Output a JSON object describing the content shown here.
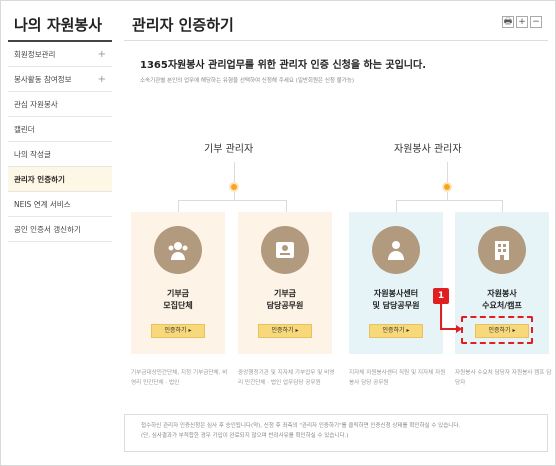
{
  "sidebar": {
    "title": "나의 자원봉사",
    "items": [
      {
        "label": "회원정보관리",
        "expand": "+"
      },
      {
        "label": "봉사활동 참여정보",
        "expand": "+"
      },
      {
        "label": "관심 자원봉사",
        "expand": ""
      },
      {
        "label": "캘린더",
        "expand": ""
      },
      {
        "label": "나의 작성글",
        "expand": ""
      },
      {
        "label": "관리자 인증하기",
        "expand": ""
      },
      {
        "label": "NEIS 연계 서비스",
        "expand": ""
      },
      {
        "label": "공인 인증서 갱신하기",
        "expand": ""
      }
    ]
  },
  "header": {
    "title": "관리자 인증하기",
    "tools": [
      "🖶",
      "+",
      "−"
    ]
  },
  "main": {
    "headline": "1365자원봉사 관리업무를 위한 관리자 인증 신청을 하는 곳입니다.",
    "subtext": "소속기관별 본인의 업무에 해당하는 유형을 선택하여 신청해 주세요 (일반회원은 신청 불가능)",
    "sections": [
      "기부 관리자",
      "자원봉사 관리자"
    ],
    "cards": [
      {
        "label": "기부금\n모집단체",
        "button": "인증하기 ▸",
        "icon": "people-icon"
      },
      {
        "label": "기부금\n담당공무원",
        "button": "인증하기 ▸",
        "icon": "id-card-icon"
      },
      {
        "label": "자원봉사센터\n및 담당공무원",
        "button": "인증하기 ▸",
        "icon": "person-icon"
      },
      {
        "label": "자원봉사\n수요처/캠프",
        "button": "인증하기 ▸",
        "icon": "building-icon"
      }
    ],
    "descriptions": [
      "기부금대상민간단체, 지정 기부금단체, 비영리 민간단체 · 법인",
      "중앙행정기관 및 지자체 기부업무 및 비영리 민간단체 · 법인 업무담당 공무원",
      "지자체 자원봉사센터 직원 및 지자체 자원봉사 담당 공무원",
      "자원봉사 수요처 담당자 자원봉사 캠프 담당자"
    ],
    "notice": [
      "접수하신 관리자 인증신청은 심사 후 승인됩니다(약), 신청 후 좌측의 \"관리자 인증하기\"를 클릭하면 인증신청 상태를 확인하실 수 있습니다.",
      "(단, 심사결과가 부적합한 경우 가입이 완료되지 않으며 반려사유를 확인하실 수 있습니다.)"
    ]
  },
  "annotation": {
    "number": "1"
  },
  "colors": {
    "accent": "#f6a623",
    "button": "#f7d87a",
    "card_warm": "#fdf3e7",
    "card_cool": "#e7f4f7",
    "annotation": "#e02020"
  }
}
